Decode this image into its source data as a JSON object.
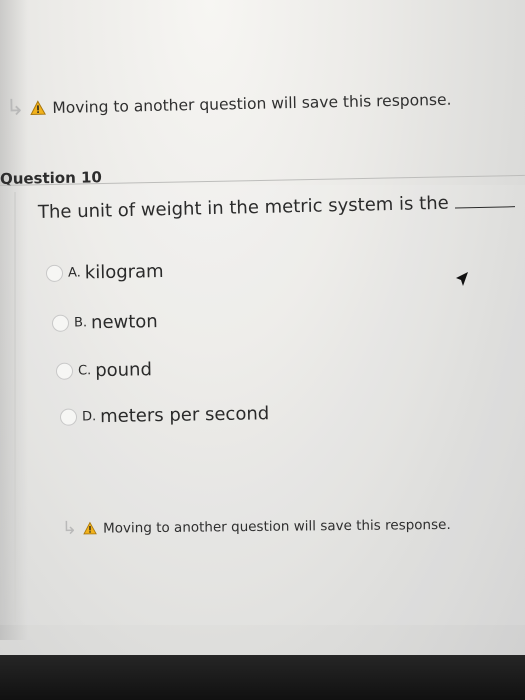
{
  "notice": {
    "text": "Moving to another question will save this response.",
    "arrow_icon": "return-arrow-icon",
    "warning_icon": "warning-triangle-icon",
    "warning_color": "#f2b21b"
  },
  "question": {
    "header": "Question 10",
    "prompt": "The unit of weight in the metric system is the",
    "options": [
      {
        "letter": "A.",
        "text": "kilogram"
      },
      {
        "letter": "B.",
        "text": "newton"
      },
      {
        "letter": "C.",
        "text": "pound"
      },
      {
        "letter": "D.",
        "text": "meters per second"
      }
    ]
  }
}
